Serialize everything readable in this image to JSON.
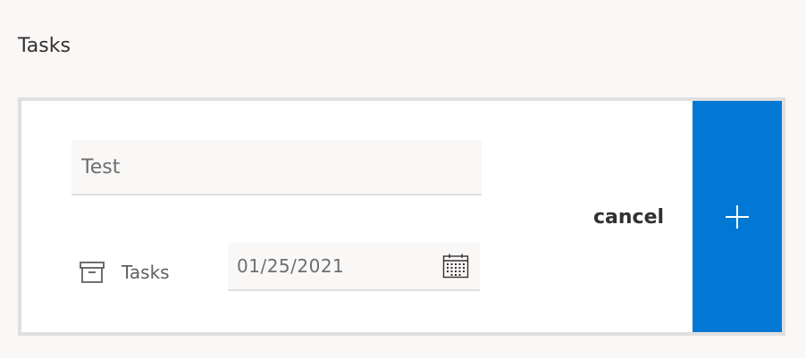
{
  "page": {
    "title": "Tasks"
  },
  "new_task": {
    "title_value": "Test",
    "list_name": "Tasks",
    "due_date": "01/25/2021",
    "cancel_label": "cancel"
  },
  "icons": {
    "list": "archive-icon",
    "date": "calendar-icon",
    "add": "plus-icon"
  },
  "colors": {
    "accent": "#0078d4",
    "background": "#f9f8f7",
    "card_border": "#e1dfdd"
  }
}
